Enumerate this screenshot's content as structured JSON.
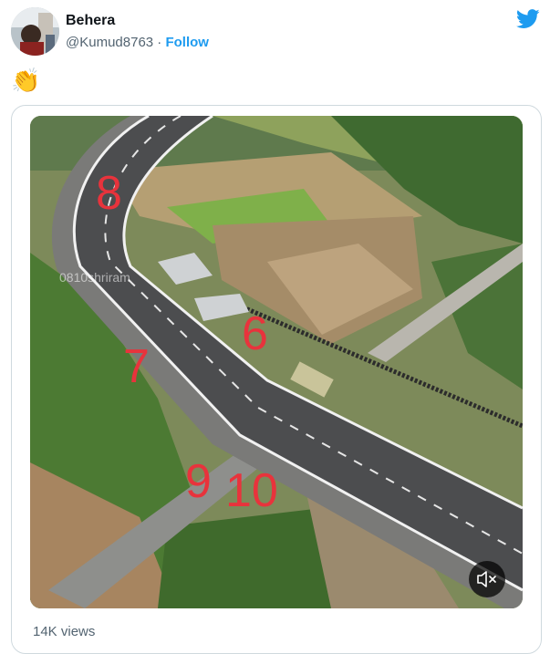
{
  "tweet": {
    "display_name": "Behera",
    "handle": "@Kumud8763",
    "separator": "·",
    "follow_label": "Follow",
    "text": "👏",
    "brand_color": "#1d9bf0"
  },
  "video": {
    "overlay_numbers": [
      "8",
      "7",
      "6",
      "9",
      "10"
    ],
    "watermark": "0810shriram",
    "number_color": "#e8333c",
    "controls": {
      "mute_icon": "speaker-muted-icon"
    }
  },
  "footer": {
    "views_text": "14K views"
  }
}
